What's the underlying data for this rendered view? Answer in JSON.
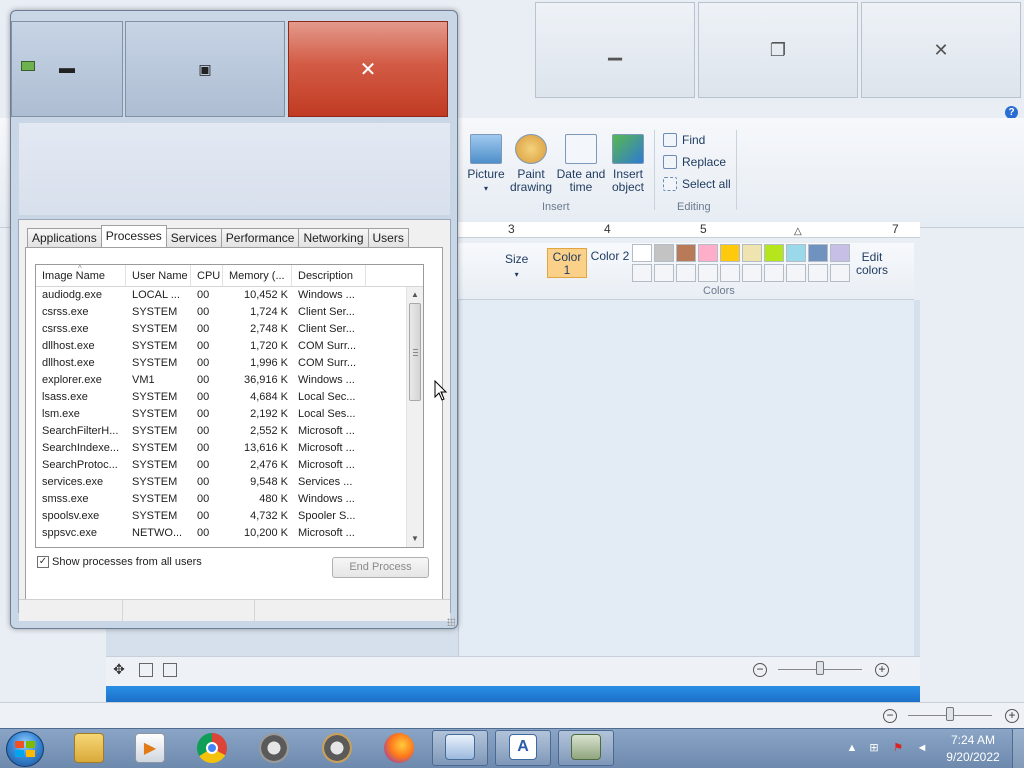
{
  "wordpad": {
    "ribbon": {
      "insert_items": [
        {
          "label": "Picture",
          "sub": "▾"
        },
        {
          "label": "Paint drawing"
        },
        {
          "label": "Date and time"
        },
        {
          "label": "Insert object"
        }
      ],
      "insert_group": "Insert",
      "editing_items": [
        "Find",
        "Replace",
        "Select all"
      ],
      "editing_group": "Editing"
    },
    "ruler_numbers": [
      "3",
      "4",
      "5",
      "7"
    ]
  },
  "paint": {
    "size_label": "Size",
    "color1_label": "Color 1",
    "color2_label": "Color 2",
    "edit_colors_label": "Edit colors",
    "colors_group": "Colors",
    "palette_top": [
      "#ffffff",
      "#c3c3c3",
      "#b97a57",
      "#ffaec9",
      "#ffc90e",
      "#efe4b0",
      "#b5e61d",
      "#99d9ea",
      "#7092be",
      "#c8bfe7"
    ]
  },
  "taskmanager": {
    "tabs": [
      "Applications",
      "Processes",
      "Services",
      "Performance",
      "Networking",
      "Users"
    ],
    "active_tab": "Processes",
    "columns": [
      "Image Name",
      "User Name",
      "CPU",
      "Memory (...",
      "Description"
    ],
    "rows": [
      {
        "name": "audiodg.exe",
        "user": "LOCAL ...",
        "cpu": "00",
        "mem": "10,452 K",
        "desc": "Windows ..."
      },
      {
        "name": "csrss.exe",
        "user": "SYSTEM",
        "cpu": "00",
        "mem": "1,724 K",
        "desc": "Client Ser..."
      },
      {
        "name": "csrss.exe",
        "user": "SYSTEM",
        "cpu": "00",
        "mem": "2,748 K",
        "desc": "Client Ser..."
      },
      {
        "name": "dllhost.exe",
        "user": "SYSTEM",
        "cpu": "00",
        "mem": "1,720 K",
        "desc": "COM Surr..."
      },
      {
        "name": "dllhost.exe",
        "user": "SYSTEM",
        "cpu": "00",
        "mem": "1,996 K",
        "desc": "COM Surr..."
      },
      {
        "name": "explorer.exe",
        "user": "VM1",
        "cpu": "00",
        "mem": "36,916 K",
        "desc": "Windows ..."
      },
      {
        "name": "lsass.exe",
        "user": "SYSTEM",
        "cpu": "00",
        "mem": "4,684 K",
        "desc": "Local Sec..."
      },
      {
        "name": "lsm.exe",
        "user": "SYSTEM",
        "cpu": "00",
        "mem": "2,192 K",
        "desc": "Local Ses..."
      },
      {
        "name": "SearchFilterH...",
        "user": "SYSTEM",
        "cpu": "00",
        "mem": "2,552 K",
        "desc": "Microsoft ..."
      },
      {
        "name": "SearchIndexe...",
        "user": "SYSTEM",
        "cpu": "00",
        "mem": "13,616 K",
        "desc": "Microsoft ..."
      },
      {
        "name": "SearchProtoc...",
        "user": "SYSTEM",
        "cpu": "00",
        "mem": "2,476 K",
        "desc": "Microsoft ..."
      },
      {
        "name": "services.exe",
        "user": "SYSTEM",
        "cpu": "00",
        "mem": "9,548 K",
        "desc": "Services ..."
      },
      {
        "name": "smss.exe",
        "user": "SYSTEM",
        "cpu": "00",
        "mem": "480 K",
        "desc": "Windows ..."
      },
      {
        "name": "spoolsv.exe",
        "user": "SYSTEM",
        "cpu": "00",
        "mem": "4,732 K",
        "desc": "Spooler S..."
      },
      {
        "name": "sppsvc.exe",
        "user": "NETWO...",
        "cpu": "00",
        "mem": "10,200 K",
        "desc": "Microsoft ..."
      }
    ],
    "show_all_label": "Show processes from all users",
    "show_all_checked": "✓",
    "end_process_label": "End Process"
  },
  "taskbar": {
    "time": "7:24 AM",
    "date": "9/20/2022"
  },
  "colors": {
    "close_red": "#c13b23",
    "taskbar": "#6d89ad",
    "accent_blue": "#1c6fc9"
  }
}
